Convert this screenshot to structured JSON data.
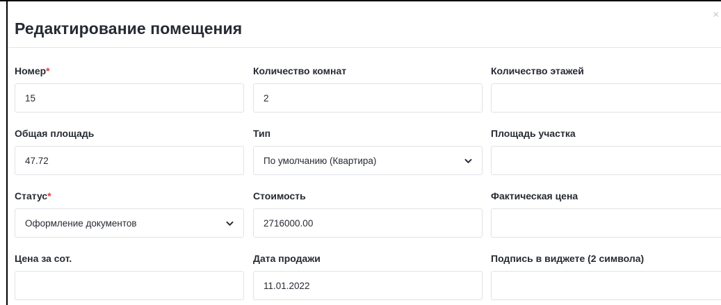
{
  "dialog": {
    "title": "Редактирование помещения",
    "close_symbol": "×",
    "required_mark": "*"
  },
  "fields": {
    "number": {
      "label": "Номер",
      "value": "15"
    },
    "rooms_count": {
      "label": "Количество комнат",
      "value": "2"
    },
    "floors_count": {
      "label": "Количество этажей",
      "value": ""
    },
    "total_area": {
      "label": "Общая площадь",
      "value": "47.72"
    },
    "type": {
      "label": "Тип",
      "value": "По умолчанию (Квартира)"
    },
    "plot_area": {
      "label": "Площадь участка",
      "value": ""
    },
    "status": {
      "label": "Статус",
      "value": "Оформление документов"
    },
    "cost": {
      "label": "Стоимость",
      "value": "2716000.00"
    },
    "actual_price": {
      "label": "Фактическая цена",
      "value": ""
    },
    "price_per_sotka": {
      "label": "Цена за сот.",
      "value": ""
    },
    "sale_date": {
      "label": "Дата продажи",
      "value": "11.01.2022"
    },
    "widget_caption": {
      "label": "Подпись в виджете (2 символа)",
      "value": ""
    }
  },
  "icons": {
    "close": "close-icon",
    "dropdown": "chevron-down-icon"
  },
  "colors": {
    "required": "#e03a3a",
    "border": "#dfe2e6"
  }
}
